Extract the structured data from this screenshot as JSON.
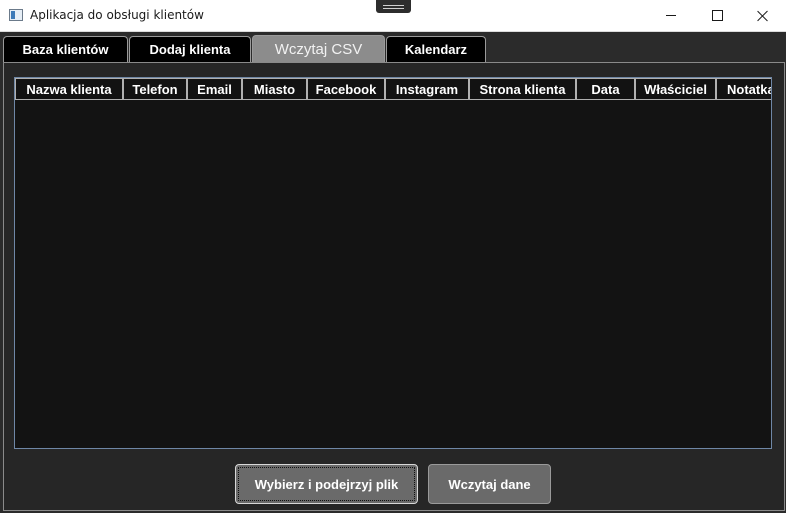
{
  "window": {
    "title": "Aplikacja do obsługi klientów"
  },
  "tabs": [
    {
      "label": "Baza klientów"
    },
    {
      "label": "Dodaj klienta"
    },
    {
      "label": "Wczytaj CSV"
    },
    {
      "label": "Kalendarz"
    }
  ],
  "active_tab": "Wczytaj CSV",
  "grid": {
    "columns": [
      "Nazwa klienta",
      "Telefon",
      "Email",
      "Miasto",
      "Facebook",
      "Instagram",
      "Strona klienta",
      "Data",
      "Właściciel",
      "Notatka"
    ],
    "rows": []
  },
  "buttons": {
    "pick_file": "Wybierz i podejrzyj plik",
    "load_data": "Wczytaj dane"
  },
  "colors": {
    "tab_active_bg": "#8c8c8c",
    "tab_bg": "#000000",
    "grid_bg": "#131313",
    "button_bg": "#6a6a6a"
  }
}
